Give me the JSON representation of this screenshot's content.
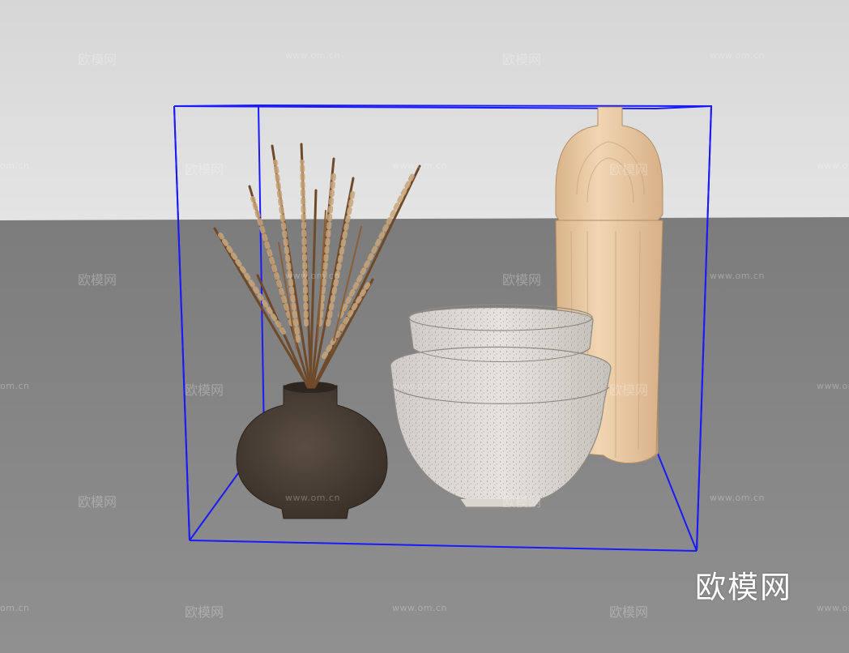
{
  "watermark": {
    "logo_text": "欧模网",
    "site_text": "www.om.cn",
    "cn_short": "om.cn"
  },
  "scene": {
    "objects": [
      "vase-with-dried-grass",
      "stacked-bowls",
      "wooden-bottle"
    ],
    "colors": {
      "wall": "#d9d9d9",
      "floor": "#8a8a8a",
      "selection_box": "#1a1aff",
      "vase": "#4a3f36",
      "bowl": "#d4d0ca",
      "bottle": "#e8c9a2"
    }
  }
}
